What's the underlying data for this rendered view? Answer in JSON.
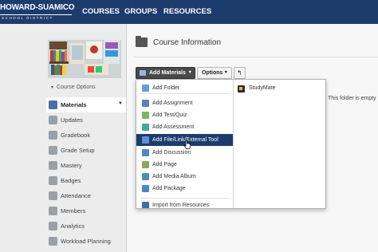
{
  "logo": {
    "main": "HOWARD-SUAMICO",
    "sub": "SCHOOL DISTRICT"
  },
  "nav": [
    {
      "label": "COURSES"
    },
    {
      "label": "GROUPS"
    },
    {
      "label": "RESOURCES"
    }
  ],
  "sidebar": {
    "course_options_label": "Course Options",
    "items": [
      {
        "label": "Materials",
        "icon": "materials-icon",
        "active": true
      },
      {
        "label": "Updates",
        "icon": "updates-icon"
      },
      {
        "label": "Gradebook",
        "icon": "gradebook-icon"
      },
      {
        "label": "Grade Setup",
        "icon": "grade-setup-icon"
      },
      {
        "label": "Mastery",
        "icon": "mastery-icon"
      },
      {
        "label": "Badges",
        "icon": "badges-icon"
      },
      {
        "label": "Attendance",
        "icon": "attendance-icon"
      },
      {
        "label": "Members",
        "icon": "members-icon"
      },
      {
        "label": "Analytics",
        "icon": "analytics-icon"
      },
      {
        "label": "Workload Planning",
        "icon": "workload-planning-icon"
      }
    ]
  },
  "main": {
    "title": "Course Information",
    "add_materials_label": "Add Materials",
    "options_label": "Options",
    "empty_note": "This folder is empty"
  },
  "dropdown": {
    "items": [
      {
        "label": "Add Folder",
        "icon": "folder-icon",
        "color": "#6b9bd1"
      },
      {
        "label": "Add Assignment",
        "icon": "assignment-icon",
        "color": "#5b7fb8"
      },
      {
        "label": "Add Test/Quiz",
        "icon": "test-quiz-icon",
        "color": "#7bb661"
      },
      {
        "label": "Add Assessment",
        "icon": "assessment-icon",
        "color": "#48a89a"
      },
      {
        "label": "Add File/Link/External Tool",
        "icon": "file-link-icon",
        "color": "#5b8fd6",
        "selected": true
      },
      {
        "label": "Add Discussion",
        "icon": "discussion-icon",
        "color": "#4f86c6"
      },
      {
        "label": "Add Page",
        "icon": "page-icon",
        "color": "#8aa957"
      },
      {
        "label": "Add Media Album",
        "icon": "media-album-icon",
        "color": "#4f8fbf"
      },
      {
        "label": "Add Package",
        "icon": "package-icon",
        "color": "#4c84c4"
      },
      {
        "label": "Import from Resources",
        "icon": "import-icon",
        "color": "#3f6faa"
      }
    ],
    "apps": [
      {
        "label": "StudyMate",
        "icon": "studymate-icon"
      }
    ]
  },
  "colors": {
    "nav_bg": "#1d3c6e",
    "selected_bg": "#1d3c6e",
    "add_button_bg": "#4a4a4a"
  }
}
